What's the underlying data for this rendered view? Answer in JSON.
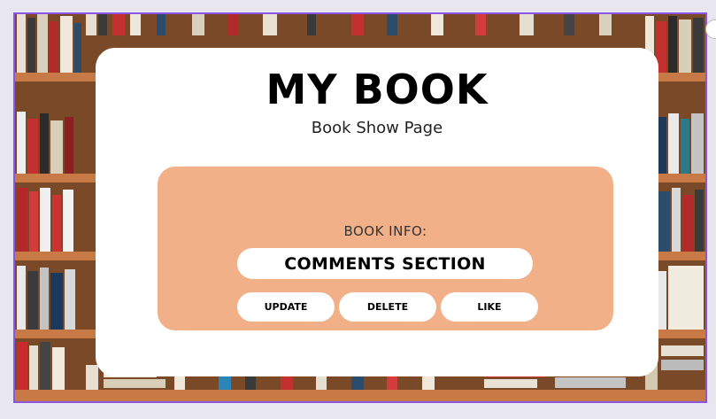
{
  "page": {
    "title": "MY BOOK",
    "subtitle": "Book Show Page"
  },
  "info": {
    "label": "BOOK INFO:",
    "comments": "COMMENTS SECTION"
  },
  "actions": {
    "update_label": "UPDATE",
    "delete_label": "DELETE",
    "like_label": "LIKE"
  },
  "colors": {
    "panel": "#f2b088",
    "card": "#ffffff",
    "frame_border": "#8a56e8"
  }
}
